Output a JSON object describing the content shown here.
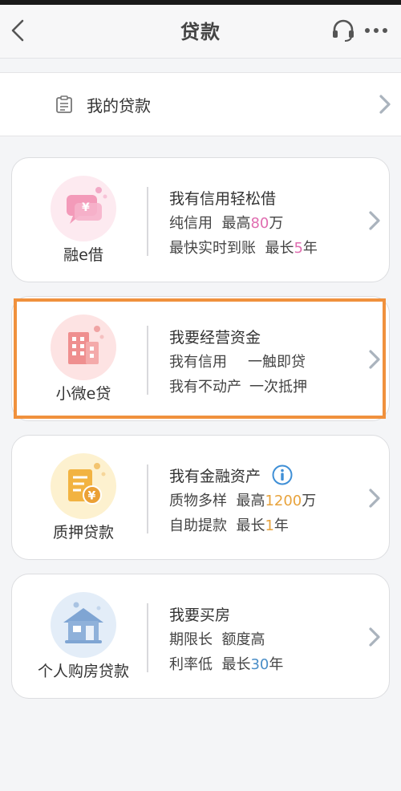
{
  "header": {
    "title": "贷款"
  },
  "my_loans": {
    "label": "我的贷款"
  },
  "products": [
    {
      "name": "融e借",
      "title": "我有信用轻松借",
      "line2_prefix": "纯信用  最高",
      "line2_value": "80",
      "line2_suffix": "万",
      "line3_prefix": "最快实时到账  最长",
      "line3_value": "5",
      "line3_suffix": "年"
    },
    {
      "name": "小微e贷",
      "title": "我要经营资金",
      "line2_a": "我有信用",
      "line2_b": "一触即贷",
      "line3_a": "我有不动产",
      "line3_b": "一次抵押"
    },
    {
      "name": "质押贷款",
      "title": "我有金融资产",
      "line2_prefix": "质物多样  最高",
      "line2_value": "1200",
      "line2_suffix": "万",
      "line3_prefix": "自助提款  最长",
      "line3_value": "1",
      "line3_suffix": "年"
    },
    {
      "name": "个人购房贷款",
      "title": "我要买房",
      "line2": "期限长  额度高",
      "line3_prefix": "利率低  最长",
      "line3_value": "30",
      "line3_suffix": "年"
    }
  ],
  "colors": {
    "accent_pink": "#e06db0",
    "accent_orange": "#e8a33c",
    "accent_blue": "#4a8ec7",
    "highlight_frame": "#f0913d"
  }
}
